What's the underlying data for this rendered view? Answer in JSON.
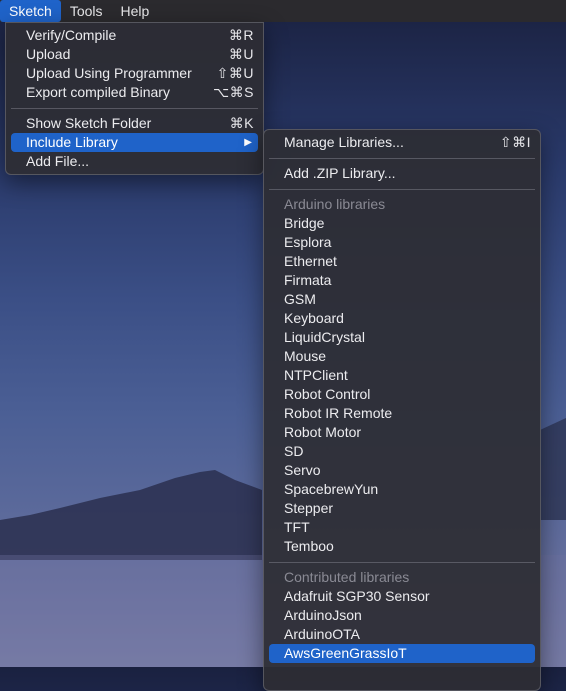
{
  "menubar": {
    "items": [
      {
        "label": "Sketch",
        "active": true
      },
      {
        "label": "Tools",
        "active": false
      },
      {
        "label": "Help",
        "active": false
      }
    ]
  },
  "sketch_menu": {
    "items": [
      {
        "label": "Verify/Compile",
        "shortcut": "⌘R"
      },
      {
        "label": "Upload",
        "shortcut": "⌘U"
      },
      {
        "label": "Upload Using Programmer",
        "shortcut": "⇧⌘U"
      },
      {
        "label": "Export compiled Binary",
        "shortcut": "⌥⌘S"
      },
      {
        "label": "Show Sketch Folder",
        "shortcut": "⌘K"
      },
      {
        "label": "Include Library",
        "shortcut": "▶"
      },
      {
        "label": "Add File...",
        "shortcut": ""
      }
    ]
  },
  "library_menu": {
    "manage": {
      "label": "Manage Libraries...",
      "shortcut": "⇧⌘I"
    },
    "add_zip": {
      "label": "Add .ZIP Library..."
    },
    "arduino_section": "Arduino libraries",
    "arduino_libraries": [
      "Bridge",
      "Esplora",
      "Ethernet",
      "Firmata",
      "GSM",
      "Keyboard",
      "LiquidCrystal",
      "Mouse",
      "NTPClient",
      "Robot Control",
      "Robot IR Remote",
      "Robot Motor",
      "SD",
      "Servo",
      "SpacebrewYun",
      "Stepper",
      "TFT",
      "Temboo"
    ],
    "contributed_section": "Contributed libraries",
    "contributed_libraries": [
      "Adafruit SGP30 Sensor",
      "ArduinoJson",
      "ArduinoOTA",
      "AwsGreenGrassIoT"
    ],
    "highlighted": "AwsGreenGrassIoT"
  },
  "colors": {
    "accent": "#1f63c9",
    "menu_bg": "#2d2d34",
    "section_text": "#8a8a94"
  }
}
